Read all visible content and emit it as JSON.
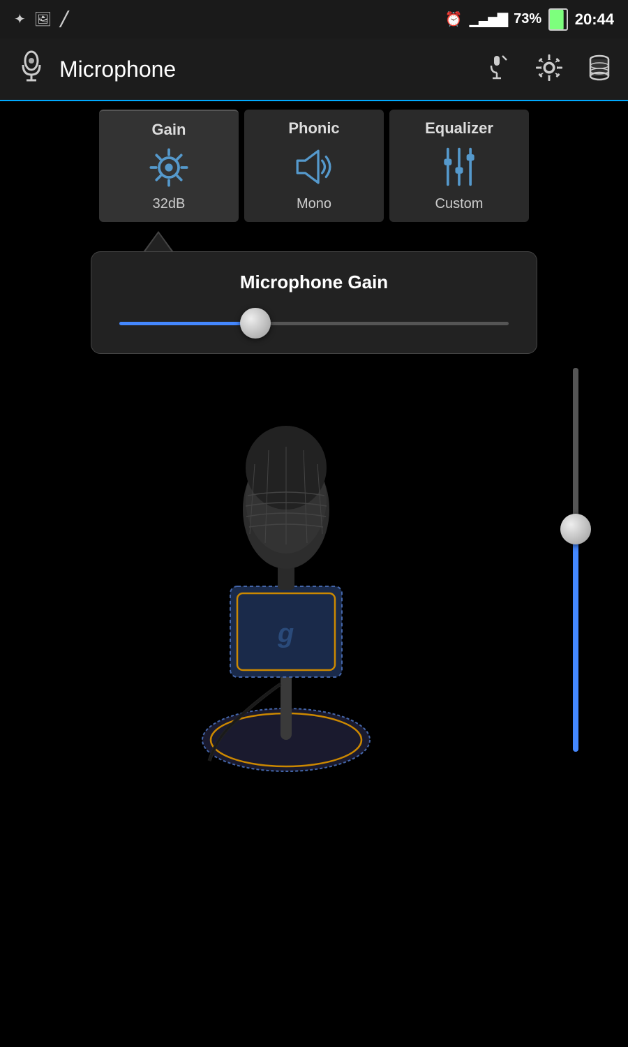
{
  "statusBar": {
    "icons": [
      "★",
      "🖼",
      "⚡"
    ],
    "clockIcon": "⏰",
    "signalBars": "📶",
    "batteryPercent": "73%",
    "batteryIcon": "🔋",
    "time": "20:44"
  },
  "appBar": {
    "title": "Microphone",
    "micIcon": "🎤",
    "icons": [
      "mic2",
      "settings",
      "database"
    ]
  },
  "tabs": [
    {
      "id": "gain",
      "label": "Gain",
      "sublabel": "32dB",
      "active": true
    },
    {
      "id": "phonic",
      "label": "Phonic",
      "sublabel": "Mono",
      "active": false
    },
    {
      "id": "equalizer",
      "label": "Equalizer",
      "sublabel": "Custom",
      "active": false
    }
  ],
  "gainPanel": {
    "title": "Microphone Gain",
    "sliderValue": 35
  },
  "verticalSlider": {
    "value": 55
  },
  "accentColor": "#4488ff"
}
